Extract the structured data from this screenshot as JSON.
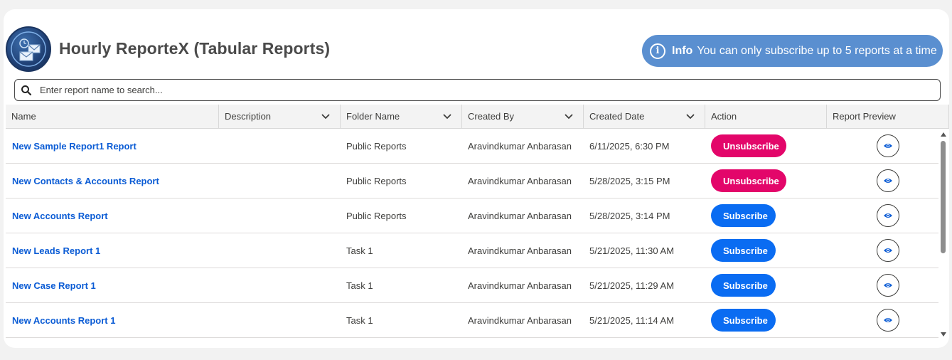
{
  "app": {
    "title": "Hourly ReporteX (Tabular Reports)",
    "logo_icon": "envelope-clock-logo-icon"
  },
  "info": {
    "label": "Info",
    "message": "You can only subscribe up to 5 reports at a time",
    "icon": "info-icon",
    "color": "#5a8fd0"
  },
  "search": {
    "placeholder": "Enter report name to search...",
    "value": "",
    "icon": "search-icon"
  },
  "table": {
    "columns": [
      {
        "label": "Name",
        "sortable": false
      },
      {
        "label": "Description",
        "sortable": true
      },
      {
        "label": "Folder Name",
        "sortable": true
      },
      {
        "label": "Created By",
        "sortable": true
      },
      {
        "label": "Created Date",
        "sortable": true
      },
      {
        "label": "Action",
        "sortable": false
      },
      {
        "label": "Report Preview",
        "sortable": false
      }
    ],
    "rows": [
      {
        "name": "New Sample Report1 Report",
        "description": "",
        "folder": "Public Reports",
        "created_by": "Aravindkumar Anbarasan",
        "created_date": "6/11/2025, 6:30 PM",
        "action": "Unsubscribe"
      },
      {
        "name": "New Contacts & Accounts Report",
        "description": "",
        "folder": "Public Reports",
        "created_by": "Aravindkumar Anbarasan",
        "created_date": "5/28/2025, 3:15 PM",
        "action": "Unsubscribe"
      },
      {
        "name": "New Accounts Report",
        "description": "",
        "folder": "Public Reports",
        "created_by": "Aravindkumar Anbarasan",
        "created_date": "5/28/2025, 3:14 PM",
        "action": "Subscribe"
      },
      {
        "name": "New Leads Report 1",
        "description": "",
        "folder": "Task 1",
        "created_by": "Aravindkumar Anbarasan",
        "created_date": "5/21/2025, 11:30 AM",
        "action": "Subscribe"
      },
      {
        "name": "New Case Report 1",
        "description": "",
        "folder": "Task 1",
        "created_by": "Aravindkumar Anbarasan",
        "created_date": "5/21/2025, 11:29 AM",
        "action": "Subscribe"
      },
      {
        "name": "New Accounts Report 1",
        "description": "",
        "folder": "Task 1",
        "created_by": "Aravindkumar Anbarasan",
        "created_date": "5/21/2025, 11:14 AM",
        "action": "Subscribe"
      }
    ]
  },
  "colors": {
    "link": "#0b5cd5",
    "unsubscribe": "#e3066a",
    "subscribe": "#0a6cf2"
  }
}
